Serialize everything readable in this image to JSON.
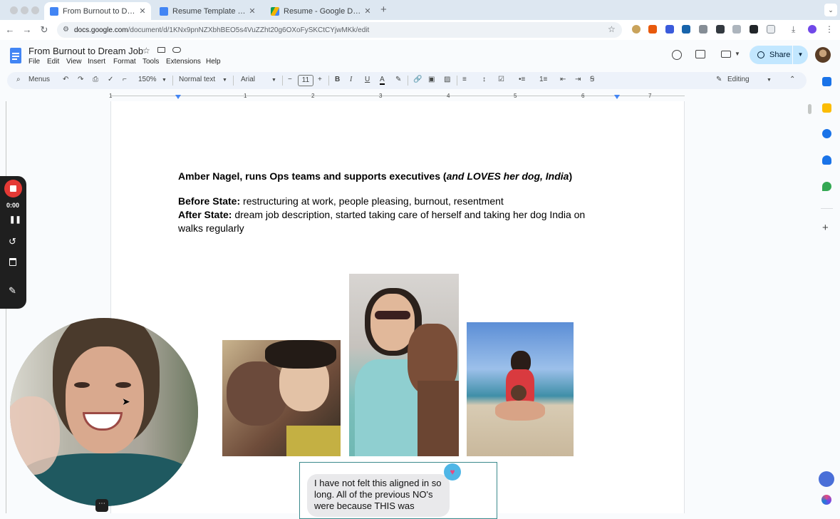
{
  "browser": {
    "tabs": [
      {
        "title": "From Burnout to Dream Job -",
        "active": true,
        "favicon": "google-docs-icon"
      },
      {
        "title": "Resume Template - Google D",
        "active": false,
        "favicon": "google-docs-icon"
      },
      {
        "title": "Resume - Google Drive",
        "active": false,
        "favicon": "google-drive-icon"
      }
    ],
    "new_tab": "+",
    "address": {
      "host": "docs.google.com",
      "path": "/document/d/1KNx9pnNZXbhBEO5s4VuZZht20g6OXoFySKCtCYjwMKk/edit"
    }
  },
  "doc": {
    "title": "From Burnout to Dream Job",
    "menus": [
      "File",
      "Edit",
      "View",
      "Insert",
      "Format",
      "Tools",
      "Extensions",
      "Help"
    ],
    "share_label": "Share"
  },
  "toolbar": {
    "search_label": "Menus",
    "zoom": "150%",
    "style": "Normal text",
    "font": "Arial",
    "font_size": "11",
    "mode": "Editing"
  },
  "ruler": {
    "numbers": [
      "1",
      "1",
      "2",
      "3",
      "4",
      "5",
      "6",
      "7"
    ]
  },
  "content": {
    "heading_name": "Amber Nagel, runs Ops teams and supports executives (",
    "heading_italic": "and LOVES her dog, India",
    "heading_end": ")",
    "before_label": "Before State:",
    "before_text": " restructuring at work, people pleasing, burnout, resentment",
    "after_label": "After State:",
    "after_text": " dream job description, started taking care of herself and taking her dog India on",
    "after_text_2": "walks regularly",
    "quote": "I have not felt this aligned in so long. All of the previous NO's were because THIS was"
  },
  "recorder": {
    "timer": "0:00"
  },
  "colors": {
    "accent": "#0b57d0",
    "share_bg": "#c2e7ff",
    "record_red": "#e53935",
    "docs_blue": "#4285f4"
  }
}
